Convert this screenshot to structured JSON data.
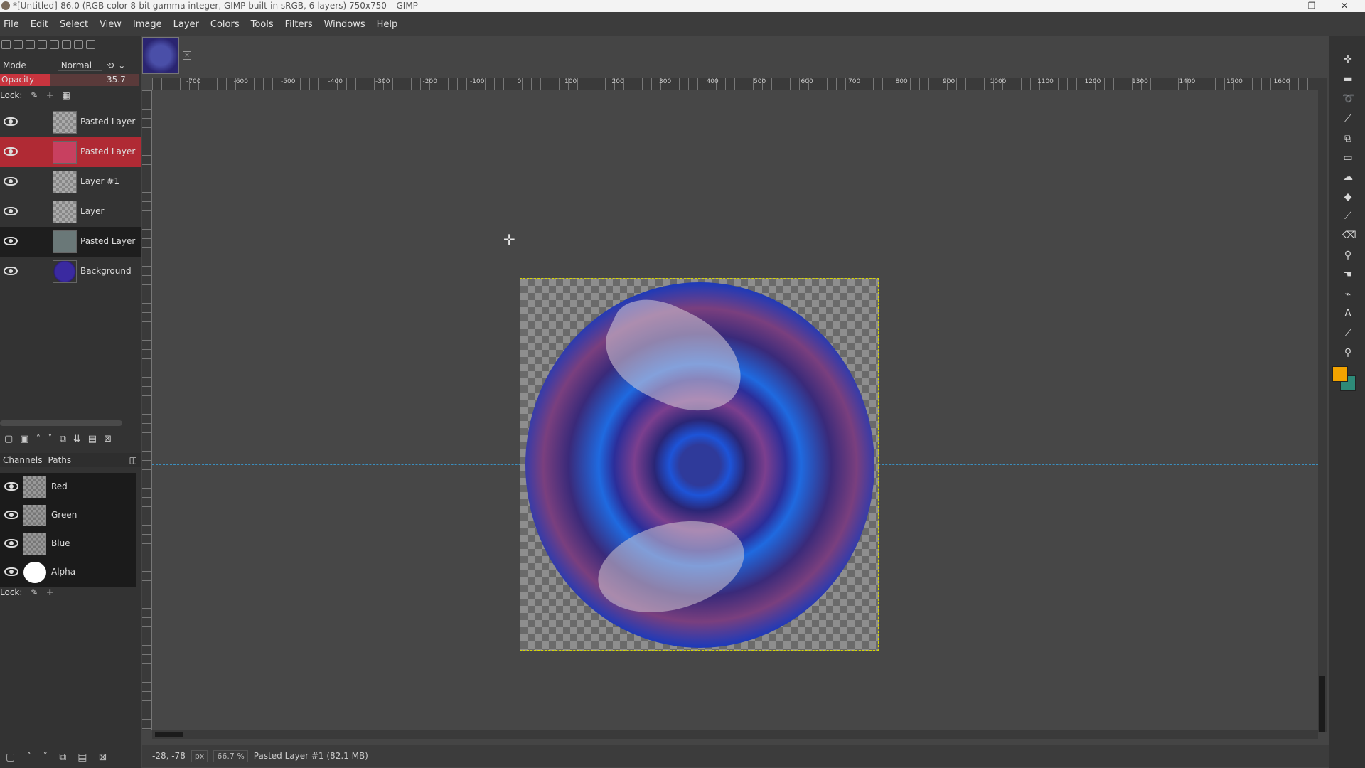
{
  "window": {
    "title": "*[Untitled]-86.0 (RGB color 8-bit gamma integer, GIMP built-in sRGB, 6 layers) 750x750 – GIMP",
    "minimize_glyph": "–",
    "maximize_glyph": "❐",
    "close_glyph": "✕"
  },
  "menu": [
    "File",
    "Edit",
    "Select",
    "View",
    "Image",
    "Layer",
    "Colors",
    "Tools",
    "Filters",
    "Windows",
    "Help"
  ],
  "layers_panel": {
    "mode_label": "Mode",
    "mode_value": "Normal",
    "opacity_label": "Opacity",
    "opacity_value": "35.7",
    "opacity_fraction": 0.357,
    "lock_label": "Lock:",
    "layers": [
      {
        "name": "Pasted Layer",
        "visible": true
      },
      {
        "name": "Pasted Layer",
        "visible": true,
        "active": true
      },
      {
        "name": "Layer #1",
        "visible": true
      },
      {
        "name": "Layer",
        "visible": true
      },
      {
        "name": "Pasted Layer",
        "visible": true
      },
      {
        "name": "Background",
        "visible": true
      }
    ]
  },
  "channels_panel": {
    "tab_channels": "Channels",
    "tab_paths": "Paths",
    "lock_label": "Lock:",
    "channels": [
      {
        "name": "Red"
      },
      {
        "name": "Green"
      },
      {
        "name": "Blue"
      },
      {
        "name": "Alpha"
      }
    ]
  },
  "ruler": {
    "ticks": [
      "-700",
      "-600",
      "-500",
      "-400",
      "-300",
      "-200",
      "-100",
      "0",
      "100",
      "200",
      "300",
      "400",
      "500",
      "600",
      "700",
      "800",
      "900",
      "1000",
      "1100",
      "1200",
      "1300",
      "1400",
      "1500",
      "1600"
    ]
  },
  "statusbar": {
    "coords": "-28, -78",
    "unit": "px",
    "zoom": "66.7 %",
    "message": "Pasted Layer #1 (82.1 MB)"
  },
  "colors": {
    "foreground": "#f2a300",
    "background": "#2e8a78",
    "active_layer_highlight": "#b02a34"
  },
  "tools": [
    "move-icon",
    "align-icon",
    "lasso-icon",
    "fuzzy-select-icon",
    "crop-icon",
    "transform-icon",
    "warp-icon",
    "bucket-fill-icon",
    "paintbrush-icon",
    "eraser-icon",
    "clone-icon",
    "smudge-icon",
    "paths-icon",
    "text-icon",
    "color-picker-icon",
    "zoom-icon"
  ]
}
